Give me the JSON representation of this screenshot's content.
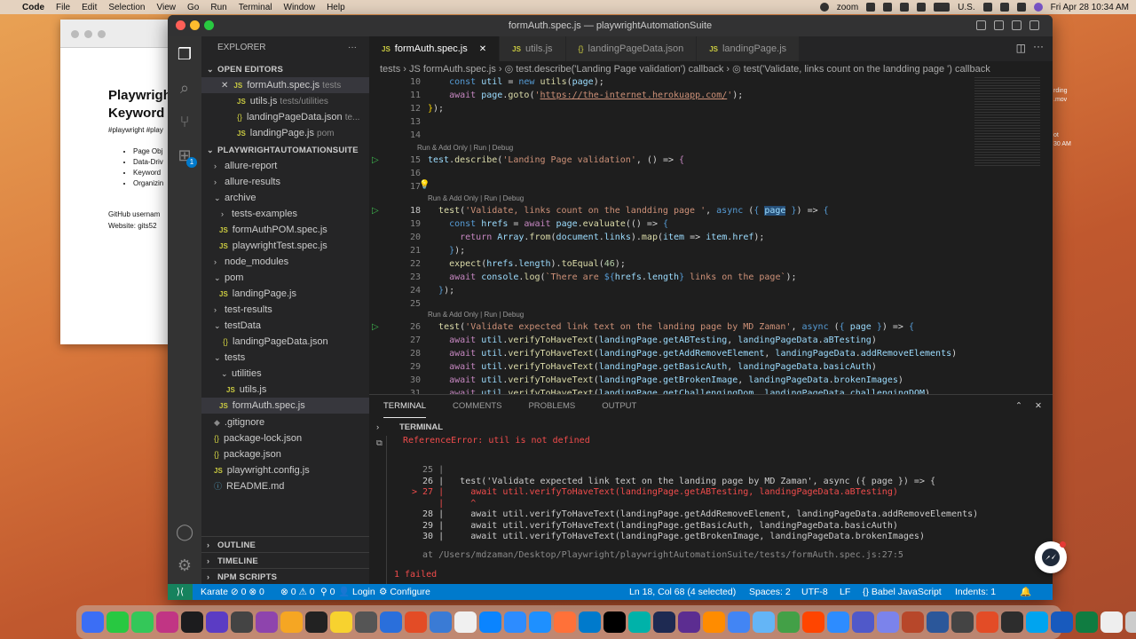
{
  "menubar": {
    "apple": "",
    "app": "Code",
    "items": [
      "File",
      "Edit",
      "Selection",
      "View",
      "Go",
      "Run",
      "Terminal",
      "Window",
      "Help"
    ],
    "zoom": "zoom",
    "input": "U.S.",
    "clock": "Fri Apr 28  10:34 AM"
  },
  "docwin": {
    "title": "Playwrigh",
    "subtitle": "Keyword D",
    "tags": "#playwright #play",
    "bullets": [
      "Page Obj",
      "Data-Driv",
      "Keyword",
      "Organizin"
    ],
    "github": "GitHub usernam",
    "website": "Website: gits52"
  },
  "rightfiles": [
    "rding",
    ".mov",
    "ot",
    "30 AM"
  ],
  "vscode": {
    "title": "formAuth.spec.js — playwrightAutomationSuite",
    "explorer_label": "EXPLORER",
    "open_editors_label": "OPEN EDITORS",
    "open_editors": [
      {
        "icon": "JS",
        "name": "formAuth.spec.js",
        "path": "tests",
        "close": "✕"
      },
      {
        "icon": "JS",
        "name": "utils.js",
        "path": "tests/utilities"
      },
      {
        "icon": "{}",
        "name": "landingPageData.json",
        "path": "te..."
      },
      {
        "icon": "JS",
        "name": "landingPage.js",
        "path": "pom"
      }
    ],
    "project_label": "PLAYWRIGHTAUTOMATIONSUITE",
    "tree": [
      {
        "name": "allure-report",
        "chev": "›"
      },
      {
        "name": "allure-results",
        "chev": "›"
      },
      {
        "name": "archive",
        "chev": "⌄"
      },
      {
        "name": "tests-examples",
        "chev": "›"
      },
      {
        "name": "formAuthPOM.spec.js",
        "icon": "JS"
      },
      {
        "name": "playwrightTest.spec.js",
        "icon": "JS"
      },
      {
        "name": "node_modules",
        "chev": "›"
      },
      {
        "name": "pom",
        "chev": "⌄"
      },
      {
        "name": "landingPage.js",
        "icon": "JS"
      },
      {
        "name": "test-results",
        "chev": "›"
      },
      {
        "name": "testData",
        "chev": "⌄"
      },
      {
        "name": "landingPageData.json",
        "icon": "{}"
      },
      {
        "name": "tests",
        "chev": "⌄"
      },
      {
        "name": "utilities",
        "chev": "⌄"
      },
      {
        "name": "utils.js",
        "icon": "JS"
      },
      {
        "name": "formAuth.spec.js",
        "icon": "JS"
      },
      {
        "name": ".gitignore",
        "icon": "◆"
      },
      {
        "name": "package-lock.json",
        "icon": "{}"
      },
      {
        "name": "package.json",
        "icon": "{}"
      },
      {
        "name": "playwright.config.js",
        "icon": "JS"
      },
      {
        "name": "README.md",
        "icon": "ⓘ"
      }
    ],
    "outline_label": "OUTLINE",
    "timeline_label": "TIMELINE",
    "npm_label": "NPM SCRIPTS",
    "badge": "1",
    "tabs": [
      {
        "icon": "JS",
        "label": "formAuth.spec.js",
        "close": "✕"
      },
      {
        "icon": "JS",
        "label": "utils.js"
      },
      {
        "icon": "{}",
        "label": "landingPageData.json"
      },
      {
        "icon": "JS",
        "label": "landingPage.js"
      }
    ],
    "breadcrumb": "tests  ›  JS formAuth.spec.js  ›  ◎ test.describe('Landing Page validation') callback  ›  ◎ test('Validate, links count on the landding page ') callback",
    "lines": [
      {
        "n": "10",
        "t": "    const util = new utils(page);"
      },
      {
        "n": "11",
        "t": "    await page.goto('https://the-internet.herokuapp.com/');"
      },
      {
        "n": "12",
        "t": "});"
      },
      {
        "n": "13",
        "t": ""
      },
      {
        "n": "14",
        "t": ""
      },
      {
        "n": "15",
        "t": "test.describe('Landing Page validation', () => {"
      },
      {
        "n": "16",
        "t": ""
      },
      {
        "n": "17",
        "t": ""
      },
      {
        "n": "18",
        "t": "  test('Validate, links count on the landding page ', async ({ page }) => {"
      },
      {
        "n": "19",
        "t": "    const hrefs = await page.evaluate(() => {"
      },
      {
        "n": "20",
        "t": "      return Array.from(document.links).map(item => item.href);"
      },
      {
        "n": "21",
        "t": "    });"
      },
      {
        "n": "22",
        "t": "    expect(hrefs.length).toEqual(46);"
      },
      {
        "n": "23",
        "t": "    await console.log(`There are ${hrefs.length} links on the page`);"
      },
      {
        "n": "24",
        "t": "  });"
      },
      {
        "n": "25",
        "t": ""
      },
      {
        "n": "26",
        "t": "  test('Validate expected link text on the landing page by MD Zaman', async ({ page }) => {"
      },
      {
        "n": "27",
        "t": "    await util.verifyToHaveText(landingPage.getABTesting, landingPageData.aBTesting)"
      },
      {
        "n": "28",
        "t": "    await util.verifyToHaveText(landingPage.getAddRemoveElement, landingPageData.addRemoveElements)"
      },
      {
        "n": "29",
        "t": "    await util.verifyToHaveText(landingPage.getBasicAuth, landingPageData.basicAuth)"
      },
      {
        "n": "30",
        "t": "    await util.verifyToHaveText(landingPage.getBrokenImage, landingPageData.brokenImages)"
      },
      {
        "n": "31",
        "t": "    await util.verifyToHaveText(landingPage.getChallengingDom, landingPageData.challengingDOM)"
      }
    ],
    "codelens": "Run & Add Only | Run | Debug",
    "panel_tabs": [
      "TERMINAL",
      "COMMENTS",
      "PROBLEMS",
      "OUTPUT"
    ],
    "terminal_label": "TERMINAL",
    "terminal": {
      "error": "ReferenceError: util is not defined",
      "l25": "  25 |",
      "l26": "  26 |   test('Validate expected link text on the landing page by MD Zaman', async ({ page }) => {",
      "l27": "> 27 |     await util.verifyToHaveText(landingPage.getABTesting, landingPageData.aBTesting)",
      "caret": "     |     ^",
      "l28": "  28 |     await util.verifyToHaveText(landingPage.getAddRemoveElement, landingPageData.addRemoveElements)",
      "l29": "  29 |     await util.verifyToHaveText(landingPage.getBasicAuth, landingPageData.basicAuth)",
      "l30": "  30 |     await util.verifyToHaveText(landingPage.getBrokenImage, landingPageData.brokenImages)",
      "at": "  at /Users/mdzaman/Desktop/Playwright/playwrightAutomationSuite/tests/formAuth.spec.js:27:5",
      "failed": "1 failed"
    },
    "status": {
      "remote": "⟩⟨",
      "karate": "Karate ⊘ 0 ⊗ 0",
      "problems": "⊗ 0 ⚠ 0",
      "ports": "⚲ 0",
      "login": "👤 Login",
      "configure": "⚙ Configure",
      "position": "Ln 18, Col 68 (4 selected)",
      "spaces": "Spaces: 2",
      "encoding": "UTF-8",
      "eol": "LF",
      "language": "{} Babel JavaScript",
      "indents": "Indents: 1",
      "bell": "🔔"
    }
  },
  "dock_colors": [
    "#3b6ef5",
    "#28c841",
    "#34c759",
    "#c13584",
    "#1c1c1e",
    "#5b3cc4",
    "#444",
    "#8e44ad",
    "#f5a623",
    "#222",
    "#f7d22f",
    "#555",
    "#2a6fdb",
    "#e34c26",
    "#3a7bd5",
    "#f0f0f0",
    "#0a84ff",
    "#2d8cff",
    "#1e90ff",
    "#ff7139",
    "#007acc",
    "#000",
    "#00b2a9",
    "#1e2a52",
    "#5c2d91",
    "#ff8c00",
    "#4285f4",
    "#64b5f6",
    "#43a047",
    "#ff4500",
    "#2d8cff",
    "#5059c9",
    "#7b83eb",
    "#b7472a",
    "#2b579a",
    "#444",
    "#e34c26",
    "#2d2d2d",
    "#00a4ef",
    "#185abd",
    "#107c41",
    "#eee",
    "#ccc"
  ]
}
